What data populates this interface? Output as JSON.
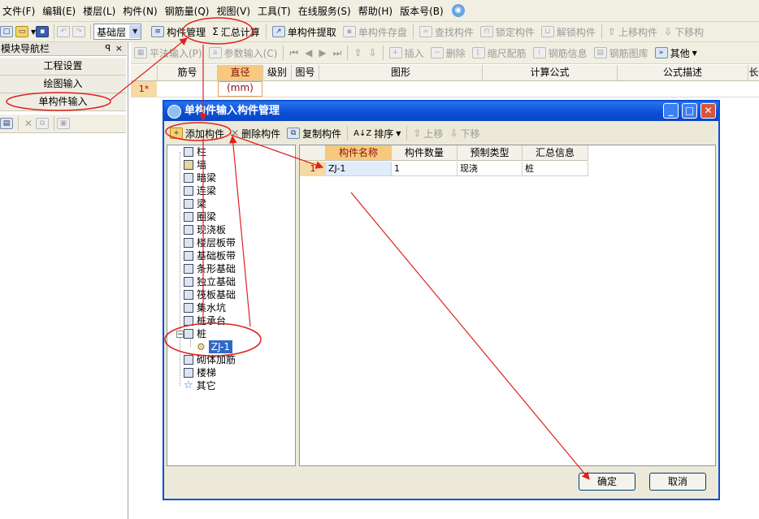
{
  "menu": [
    "文件(F)",
    "编辑(E)",
    "楼层(L)",
    "构件(N)",
    "钢筋量(Q)",
    "视图(V)",
    "工具(T)",
    "在线服务(S)",
    "帮助(H)",
    "版本号(B)"
  ],
  "toolbar1": {
    "floor_combo": "基础层",
    "component_manage": "构件管理",
    "summary_calc": "汇总计算",
    "extract": "单构件提取",
    "save_disk": "单构件存盘",
    "find": "查找构件",
    "lock": "锁定构件",
    "unlock": "解锁构件",
    "move_up": "上移构件",
    "move_down": "下移构"
  },
  "toolbar2": {
    "flat_input": "平法输入(P)",
    "param_input": "参数输入(C)",
    "insert": "插入",
    "delete": "删除",
    "scale": "缩尺配筋",
    "rebar_info": "钢筋信息",
    "rebar_lib": "钢筋图库",
    "other": "其他"
  },
  "leftnav": {
    "title": "模块导航栏",
    "pin": "ꟼ",
    "close": "×",
    "items": [
      "工程设置",
      "绘图输入",
      "单构件输入"
    ]
  },
  "grid": {
    "headers": [
      "筋号",
      "直径(mm)",
      "级别",
      "图号",
      "图形",
      "计算公式",
      "公式描述",
      "长"
    ],
    "row1": "1*"
  },
  "dialog": {
    "title": "单构件输入构件管理",
    "toolbar": {
      "add": "添加构件",
      "delete": "删除构件",
      "copy": "复制构件",
      "sort": "排序",
      "up": "上移",
      "down": "下移"
    },
    "tree": [
      "柱",
      "墙",
      "暗梁",
      "连梁",
      "梁",
      "圈梁",
      "现浇板",
      "楼层板带",
      "基础板带",
      "条形基础",
      "独立基础",
      "筏板基础",
      "集水坑",
      "桩承台",
      "桩",
      "ZJ-1",
      "砌体加筋",
      "楼梯",
      "其它"
    ],
    "list": {
      "headers": [
        "构件名称",
        "构件数量",
        "预制类型",
        "汇总信息"
      ],
      "row": {
        "num": "1",
        "name": "ZJ-1",
        "qty": "1",
        "type": "现浇",
        "summary": "桩"
      }
    },
    "ok": "确定",
    "cancel": "取消"
  },
  "colors": {
    "annotation": "#e02020",
    "title_bar": "#0a4ed6",
    "header_highlight": "#f7c97d"
  }
}
